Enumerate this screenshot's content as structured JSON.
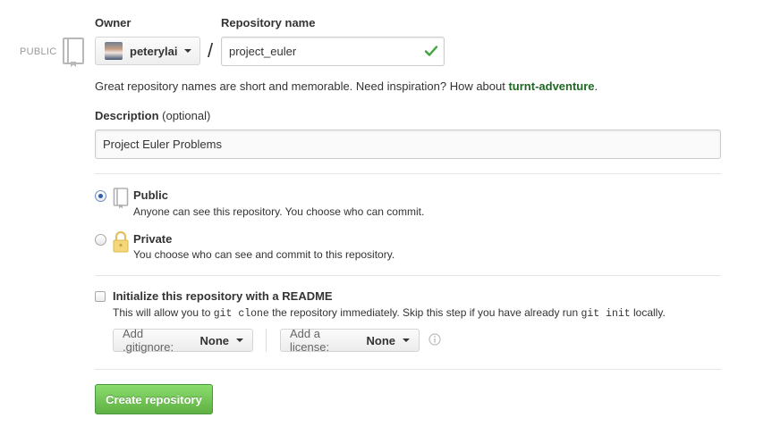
{
  "owner": {
    "label": "Owner",
    "name": "peterylai"
  },
  "visibility_tag": "PUBLIC",
  "repo": {
    "label": "Repository name",
    "separator": "/",
    "value": "project_euler"
  },
  "hint": {
    "text": "Great repository names are short and memorable. Need inspiration? How about ",
    "suggestion": "turnt-adventure",
    "end": "."
  },
  "description": {
    "label": "Description",
    "optional": "(optional)",
    "value": "Project Euler Problems"
  },
  "visibility": {
    "selected": "public",
    "options": [
      {
        "title": "Public",
        "desc": "Anyone can see this repository. You choose who can commit.",
        "icon": "book-icon"
      },
      {
        "title": "Private",
        "desc": "You choose who can see and commit to this repository.",
        "icon": "lock-icon"
      }
    ]
  },
  "readme": {
    "title": "Initialize this repository with a README",
    "desc_1": "This will allow you to ",
    "code_1": "git clone",
    "desc_2": " the repository immediately. Skip this step if you have already run ",
    "code_2": "git init",
    "desc_3": " locally.",
    "checked": false
  },
  "gitignore": {
    "label": "Add .gitignore:",
    "value": "None"
  },
  "license": {
    "label": "Add a license:",
    "value": "None"
  },
  "create_button": "Create repository",
  "colors": {
    "primary_button": "#60b044",
    "suggestion": "#1e6823",
    "check": "#3fa33f"
  }
}
